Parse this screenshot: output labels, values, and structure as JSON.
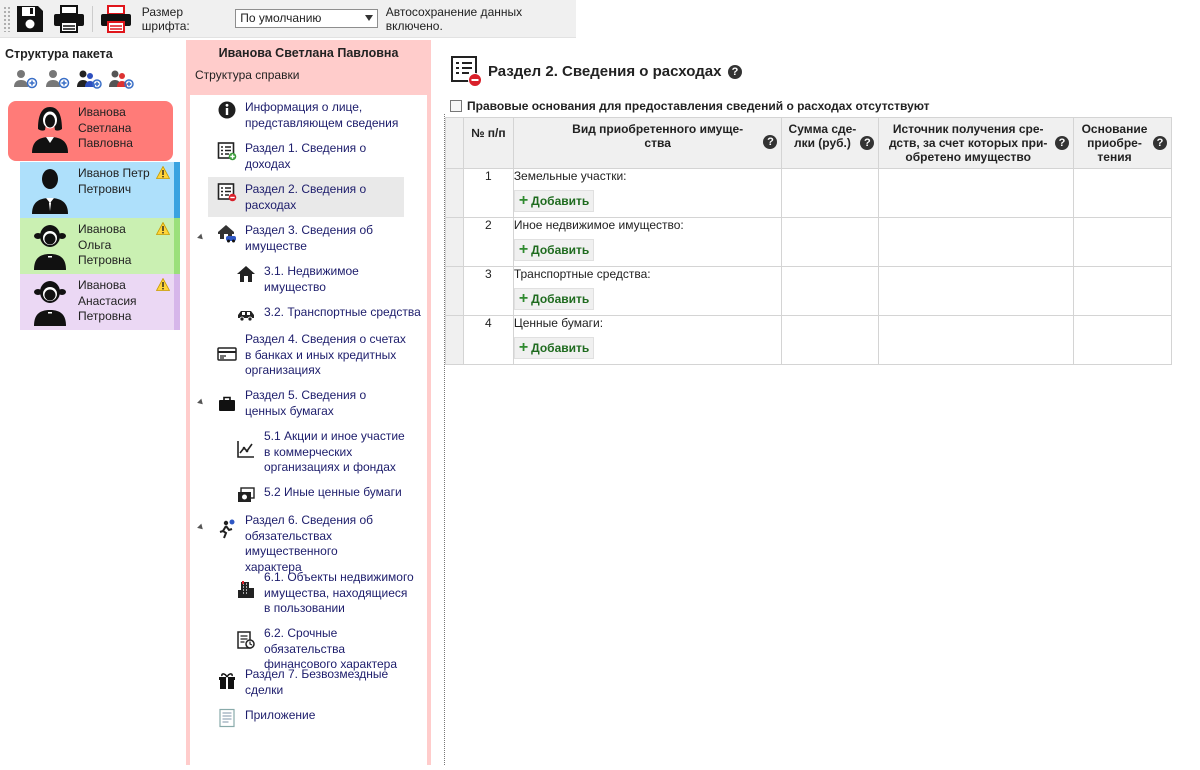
{
  "toolbar": {
    "font_size_label": "Размер шрифта:",
    "font_size_value": "По умолчанию",
    "autosave_text": "Автосохранение данных включено."
  },
  "package": {
    "title": "Структура пакета",
    "people": [
      {
        "name": "Иванова Светлана Павловна",
        "color": "#ff7b78",
        "warning": false
      },
      {
        "name": "Иванов Петр Петрович",
        "color": "#aee0fb",
        "warning": true
      },
      {
        "name": "Иванова Ольга Петровна",
        "color": "#caf0b2",
        "warning": true
      },
      {
        "name": "Иванова Анастасия Петровна",
        "color": "#ebd8f4",
        "warning": true
      }
    ]
  },
  "nav": {
    "person_name": "Иванова Светлана Павловна",
    "subtitle": "Структура справки",
    "items": [
      {
        "label": "Информация о лице, представляющем сведения",
        "icon": "info-icon"
      },
      {
        "label": "Раздел 1. Сведения о доходах",
        "icon": "income-form-icon"
      },
      {
        "label": "Раздел 2. Сведения о расходах",
        "icon": "expense-form-icon"
      },
      {
        "label": "Раздел 3. Сведения об имуществе",
        "icon": "property-icon"
      },
      {
        "label": "3.1. Недвижимое имущество",
        "icon": "house-icon"
      },
      {
        "label": "3.2. Транспортные средства",
        "icon": "car-icon"
      },
      {
        "label": "Раздел 4. Сведения о счетах в банках и иных кредитных организациях",
        "icon": "bank-card-icon"
      },
      {
        "label": "Раздел 5. Сведения о ценных бумагах",
        "icon": "briefcase-icon"
      },
      {
        "label": "5.1 Акции и иное участие в коммерческих организациях и фондах",
        "icon": "stock-chart-icon"
      },
      {
        "label": "5.2 Иные ценные бумаги",
        "icon": "securities-icon"
      },
      {
        "label": "Раздел 6. Сведения об обязательствах имущественного характера",
        "icon": "obligations-icon"
      },
      {
        "label": "6.1. Объекты недвижимого имущества, находящиеся в пользовании",
        "icon": "building-icon"
      },
      {
        "label": "6.2. Срочные обязательства финансового характера",
        "icon": "finance-doc-icon"
      },
      {
        "label": "Раздел 7. Безвозмездные сделки",
        "icon": "gift-icon"
      },
      {
        "label": "Приложение",
        "icon": "attachment-icon"
      }
    ]
  },
  "main": {
    "title": "Раздел 2. Сведения о расходах",
    "checkbox_label": "Правовые основания для предоставления сведений о расходах отсутствуют",
    "columns": [
      "№ п/п",
      "Вид приобретенного имуще- ства",
      "Сумма сде- лки (руб.)",
      "Источник получения сре- дств, за счет которых при- обретено имущество",
      "Основание приобре- тения"
    ],
    "add_label": "Добавить",
    "rows": [
      {
        "num": "1",
        "kind": "Земельные участки:"
      },
      {
        "num": "2",
        "kind": "Иное недвижимое имущество:"
      },
      {
        "num": "3",
        "kind": "Транспортные средства:"
      },
      {
        "num": "4",
        "kind": "Ценные бумаги:"
      }
    ]
  }
}
